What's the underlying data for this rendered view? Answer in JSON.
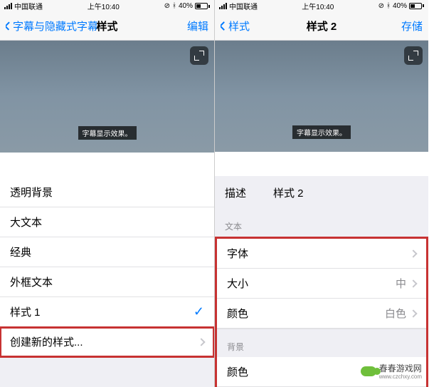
{
  "status": {
    "carrier": "中国联通",
    "time": "上午10:40",
    "battery": "40%"
  },
  "left": {
    "back": "字幕与隐藏式字幕",
    "title": "样式",
    "action": "编辑",
    "caption_sample": "字幕显示效果。",
    "rows": {
      "r1": "透明背景",
      "r2": "大文本",
      "r3": "经典",
      "r4": "外框文本",
      "r5": "样式 1",
      "r6": "创建新的样式..."
    }
  },
  "right": {
    "back": "样式",
    "title": "样式 2",
    "action": "存储",
    "caption_sample": "字幕显示效果。",
    "desc_label": "描述",
    "desc_value": "样式 2",
    "section_text": "文本",
    "section_bg": "背景",
    "rows": {
      "font": "字体",
      "size": "大小",
      "size_val": "中",
      "color": "颜色",
      "color_val": "白色",
      "bg_color": "颜色"
    }
  },
  "watermark": {
    "name": "春春游戏网",
    "url": "www.czchxy.com"
  }
}
